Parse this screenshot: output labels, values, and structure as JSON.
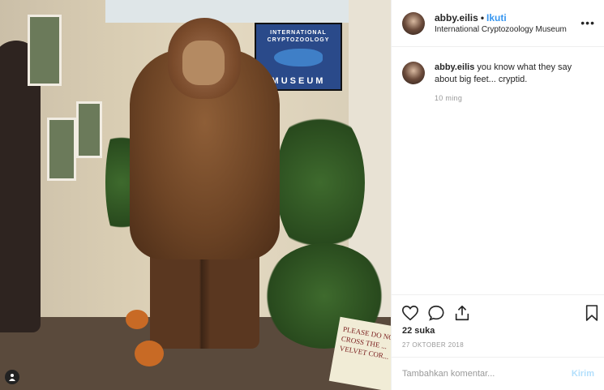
{
  "post": {
    "username": "abby.eilis",
    "separator": "•",
    "follow_label": "Ikuti",
    "location": "International Cryptozoology Museum",
    "more_label": "•••"
  },
  "caption": {
    "username": "abby.eilis",
    "text": "you know what they say about big feet... cryptid.",
    "time": "10 ming"
  },
  "photo": {
    "poster_top": "INTERNATIONAL CRYPTOZOOLOGY",
    "poster_bottom": "MUSEUM",
    "sign_text": "PLEASE DO NOT CROSS THE ... VELVET COR...",
    "corner_icon": "person-icon"
  },
  "actions": {
    "like_icon": "heart-icon",
    "comment_icon": "comment-icon",
    "share_icon": "share-icon",
    "save_icon": "bookmark-icon"
  },
  "likes": "22 suka",
  "date": "27 OKTOBER 2018",
  "comment_box": {
    "placeholder": "Tambahkan komentar...",
    "post_label": "Kirim"
  },
  "colors": {
    "link_blue": "#3897f0",
    "post_disabled": "#b2dffc",
    "muted": "#999999",
    "text": "#262626"
  }
}
